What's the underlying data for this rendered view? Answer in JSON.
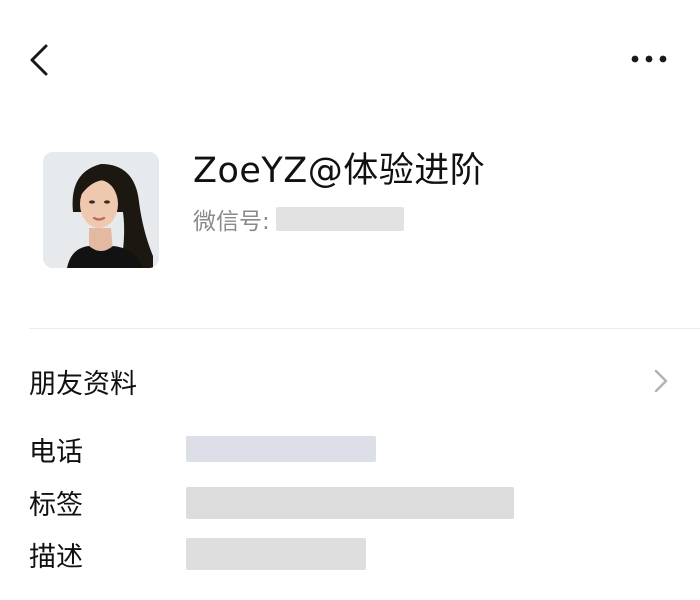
{
  "nav": {
    "back_icon": "chevron-left-icon",
    "more_icon": "more-horizontal-icon"
  },
  "profile": {
    "nickname": "ZoeYZ@体验进阶",
    "wechat_id_label": "微信号:",
    "avatar_icon": "profile-photo"
  },
  "friend_info": {
    "title": "朋友资料",
    "chevron_icon": "chevron-right-icon",
    "fields": [
      {
        "label": "电话"
      },
      {
        "label": "标签"
      },
      {
        "label": "描述"
      }
    ]
  },
  "colors": {
    "text_primary": "#111111",
    "text_secondary": "#8a8a8a",
    "divider": "#ececec",
    "redacted": "#dcdcdc"
  }
}
